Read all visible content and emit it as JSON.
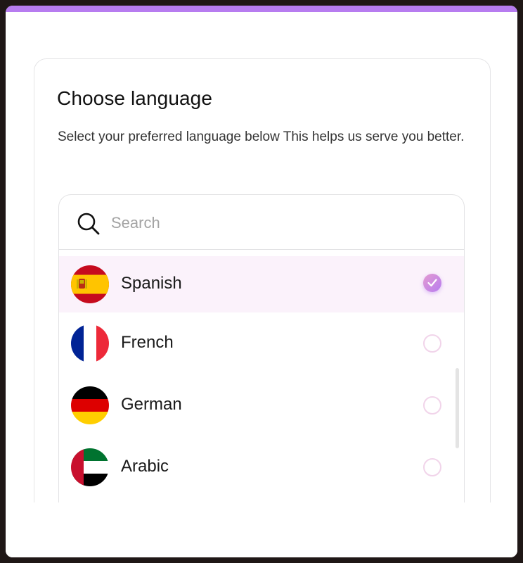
{
  "dialog": {
    "title": "Choose language",
    "subtitle": "Select your preferred language below This helps us serve you better."
  },
  "search": {
    "placeholder": "Search",
    "value": "",
    "icon": "search-icon"
  },
  "languages": [
    {
      "label": "Spanish",
      "flag": "spain-flag",
      "selected": true
    },
    {
      "label": "French",
      "flag": "france-flag",
      "selected": false
    },
    {
      "label": "German",
      "flag": "germany-flag",
      "selected": false
    },
    {
      "label": "Arabic",
      "flag": "uae-flag",
      "selected": false
    }
  ],
  "colors": {
    "accent": "#b77cf0",
    "accent_pink": "#e39bd0",
    "selected_row_bg": "#fbf2fb",
    "radio_border": "#f1d4ea"
  }
}
